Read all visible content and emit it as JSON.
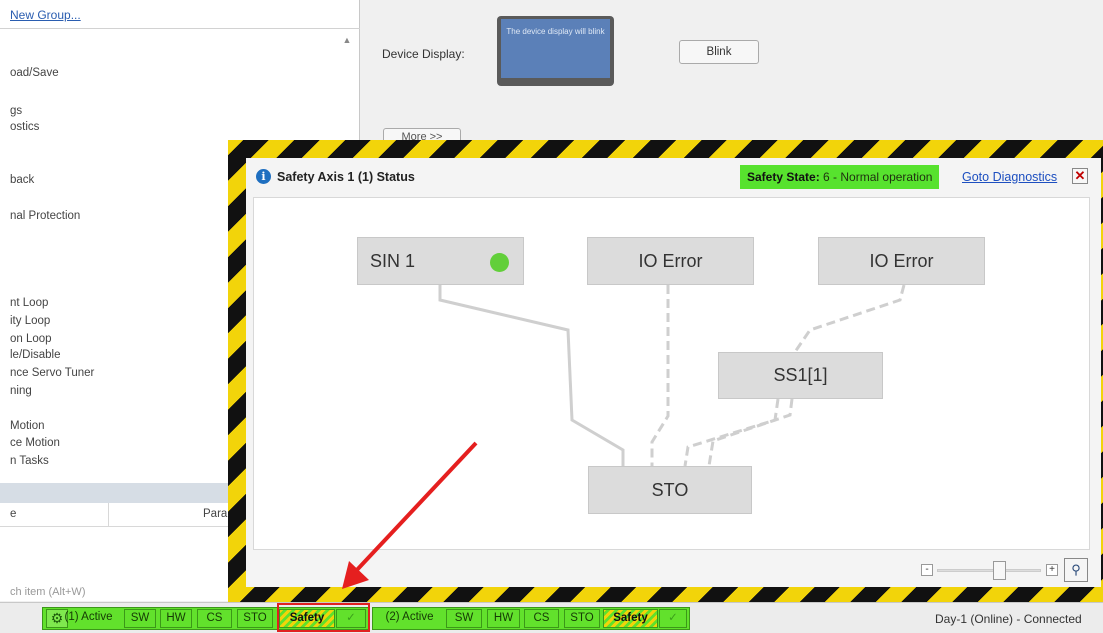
{
  "left_panel": {
    "new_group_link": "New Group...",
    "nav_items": [
      "oad/Save",
      "gs",
      "ostics",
      "back",
      "nal Protection",
      "nt Loop",
      "ity Loop",
      "on Loop",
      "le/Disable",
      "nce Servo Tuner",
      "ning",
      "Motion",
      "ce Motion",
      "n Tasks"
    ],
    "table_col1": "e",
    "table_col2": "Param",
    "search_hint": "ch item (Alt+W)"
  },
  "device_panel": {
    "label": "Device Display:",
    "display_text": "The device display will blink",
    "blink_button": "Blink",
    "more_button": "More >>"
  },
  "popup": {
    "title": "Safety Axis 1 (1) Status",
    "safety_state_label": "Safety State:",
    "safety_state_value": "6 - Normal operation",
    "goto_link": "Goto Diagnostics",
    "close": "✕",
    "nodes": {
      "sin1": "SIN 1",
      "io_error_1": "IO Error",
      "io_error_2": "IO Error",
      "ss1": "SS1[1]",
      "sto": "STO"
    },
    "led_color": "#62cf3a",
    "zoom_minus": "-",
    "zoom_plus": "+",
    "zoom_level": 0.62
  },
  "status_bar": {
    "axis1": {
      "active": "(1) Active",
      "sw": "SW",
      "hw": "HW",
      "cs": "CS",
      "sto": "STO",
      "safety": "Safety",
      "check": "✓"
    },
    "axis2": {
      "active": "(2) Active",
      "sw": "SW",
      "hw": "HW",
      "cs": "CS",
      "sto": "STO",
      "safety": "Safety",
      "check": "✓"
    },
    "connection": "Day-1 (Online) - Connected"
  },
  "colors": {
    "status_green": "#62e12c",
    "hazard_yellow": "#f2d40a",
    "highlight_red": "#e02020",
    "link_blue": "#1d4fc0"
  }
}
